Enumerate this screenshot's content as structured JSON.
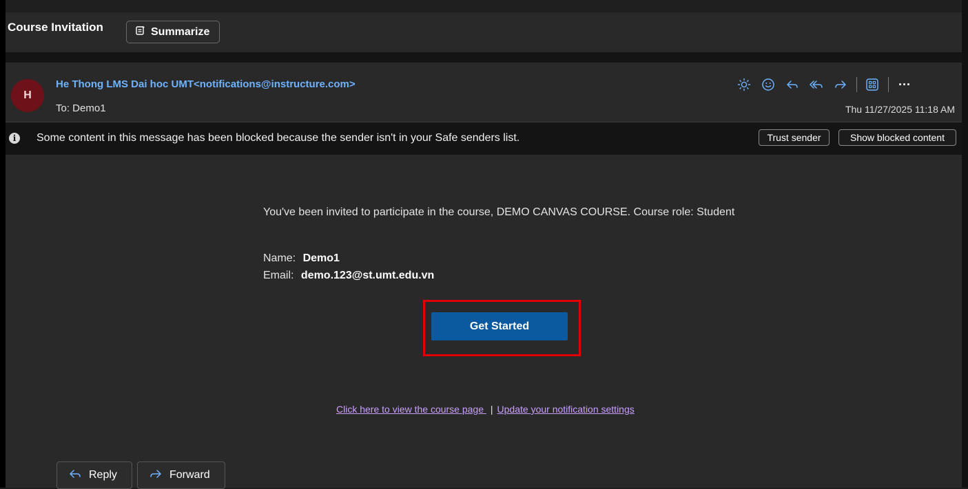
{
  "subject": {
    "title": "Course Invitation",
    "summarize_label": "Summarize"
  },
  "header": {
    "avatar_initial": "H",
    "sender": "He Thong LMS Dai hoc UMT<notifications@instructure.com>",
    "to_line": "To: Demo1",
    "date": "Thu 11/27/2025 11:18 AM",
    "action_icons": [
      "brightness-icon",
      "emoji-icon",
      "reply-icon",
      "reply-all-icon",
      "forward-icon",
      "apps-icon",
      "more-icon"
    ],
    "more_label": "···"
  },
  "info_bar": {
    "message": "Some content in this message has been blocked because the sender isn't in your Safe senders list.",
    "trust_label": "Trust sender",
    "show_label": "Show blocked content"
  },
  "body": {
    "invite_text": "You've been invited to participate in the course, DEMO CANVAS COURSE. Course role: Student",
    "name_label": "Name:",
    "name_value": "Demo1",
    "email_label": "Email:",
    "email_value": "demo.123@st.umt.edu.vn",
    "cta_label": "Get Started",
    "link_course": "Click here to view the course page ",
    "link_separator": "|",
    "link_settings": "Update your notification settings"
  },
  "actions": {
    "reply_label": "Reply",
    "forward_label": "Forward"
  },
  "colors": {
    "accent_blue": "#6fb3ff",
    "cta_blue": "#0b5aa0",
    "highlight_red": "#e00000",
    "avatar_bg": "#6e1119",
    "link_purple": "#c9a0ff"
  }
}
